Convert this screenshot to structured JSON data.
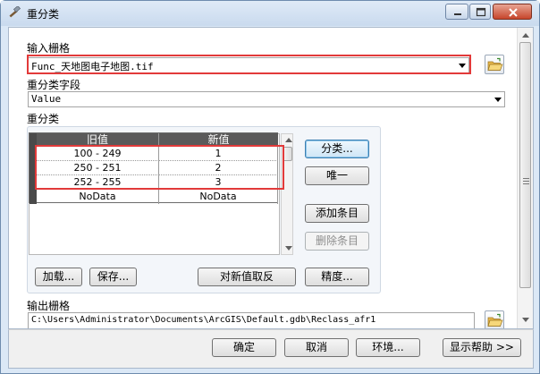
{
  "window": {
    "title": "重分类"
  },
  "input_raster": {
    "label": "输入栅格",
    "value": "Func_天地图电子地图.tif"
  },
  "reclass_field": {
    "label": "重分类字段",
    "value": "Value"
  },
  "reclassify": {
    "label": "重分类",
    "columns": [
      "旧值",
      "新值"
    ],
    "rows": [
      {
        "old": "100 - 249",
        "new": "1"
      },
      {
        "old": "250 - 251",
        "new": "2"
      },
      {
        "old": "252 - 255",
        "new": "3"
      },
      {
        "old": "NoData",
        "new": "NoData"
      }
    ],
    "buttons": {
      "classify": "分类...",
      "unique": "唯一",
      "add_entry": "添加条目",
      "delete_entry": "删除条目",
      "load": "加载...",
      "save": "保存...",
      "reverse": "对新值取反",
      "precision": "精度..."
    }
  },
  "output_raster": {
    "label": "输出栅格",
    "value": "C:\\Users\\Administrator\\Documents\\ArcGIS\\Default.gdb\\Reclass_afr1"
  },
  "footer": {
    "ok": "确定",
    "cancel": "取消",
    "environments": "环境...",
    "show_help": "显示帮助 >>"
  }
}
